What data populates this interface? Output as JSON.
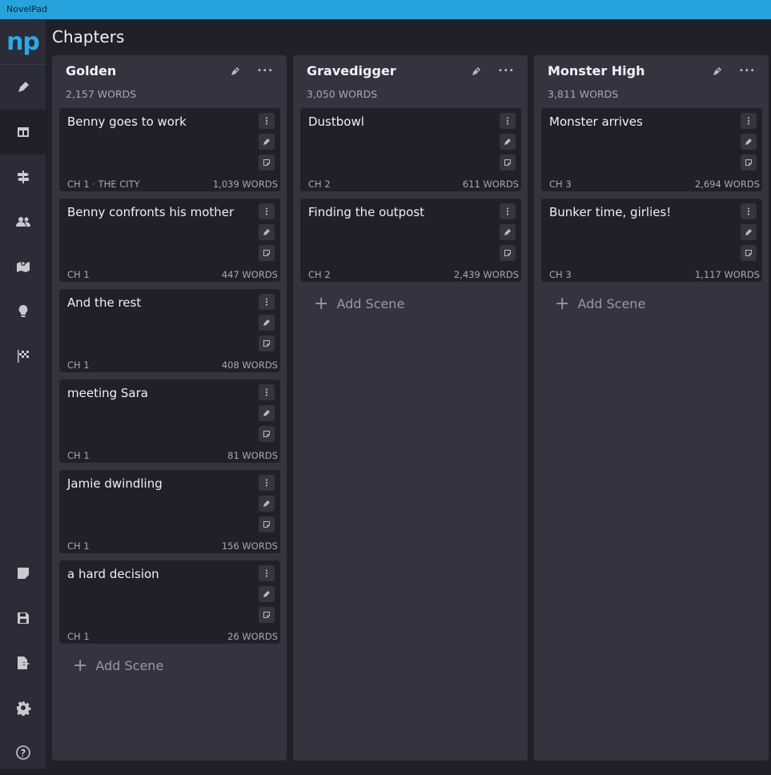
{
  "app_title": "NovelPad",
  "logo": "np",
  "page_title": "Chapters",
  "sidebar": {
    "top_items": [
      {
        "name": "pen-icon",
        "active": false
      },
      {
        "name": "board-icon",
        "active": true
      },
      {
        "name": "signpost-icon",
        "active": false
      },
      {
        "name": "characters-icon",
        "active": false
      },
      {
        "name": "map-icon",
        "active": false
      },
      {
        "name": "lightbulb-icon",
        "active": false
      },
      {
        "name": "finish-flag-icon",
        "active": false
      }
    ],
    "bottom_items": [
      "notes-icon",
      "save-icon",
      "export-icon",
      "settings-icon",
      "help-icon"
    ]
  },
  "add_scene_label": "Add Scene",
  "columns": [
    {
      "title": "Golden",
      "words": "2,157 WORDS",
      "cards": [
        {
          "title": "Benny goes to work",
          "chapter": "CH 1 · THE CITY",
          "words": "1,039 WORDS"
        },
        {
          "title": "Benny confronts his mother",
          "chapter": "CH 1",
          "words": "447 WORDS"
        },
        {
          "title": "And the rest",
          "chapter": "CH 1",
          "words": "408 WORDS"
        },
        {
          "title": "meeting Sara",
          "chapter": "CH 1",
          "words": "81 WORDS"
        },
        {
          "title": "Jamie dwindling",
          "chapter": "CH 1",
          "words": "156 WORDS"
        },
        {
          "title": "a hard decision",
          "chapter": "CH 1",
          "words": "26 WORDS"
        }
      ]
    },
    {
      "title": "Gravedigger",
      "words": "3,050 WORDS",
      "cards": [
        {
          "title": "Dustbowl",
          "chapter": "CH 2",
          "words": "611 WORDS"
        },
        {
          "title": "Finding the outpost",
          "chapter": "CH 2",
          "words": "2,439 WORDS"
        }
      ]
    },
    {
      "title": "Monster High",
      "words": "3,811 WORDS",
      "cards": [
        {
          "title": "Monster arrives",
          "chapter": "CH 3",
          "words": "2,694 WORDS"
        },
        {
          "title": "Bunker time, girlies!",
          "chapter": "CH 3",
          "words": "1,117 WORDS"
        }
      ]
    }
  ]
}
